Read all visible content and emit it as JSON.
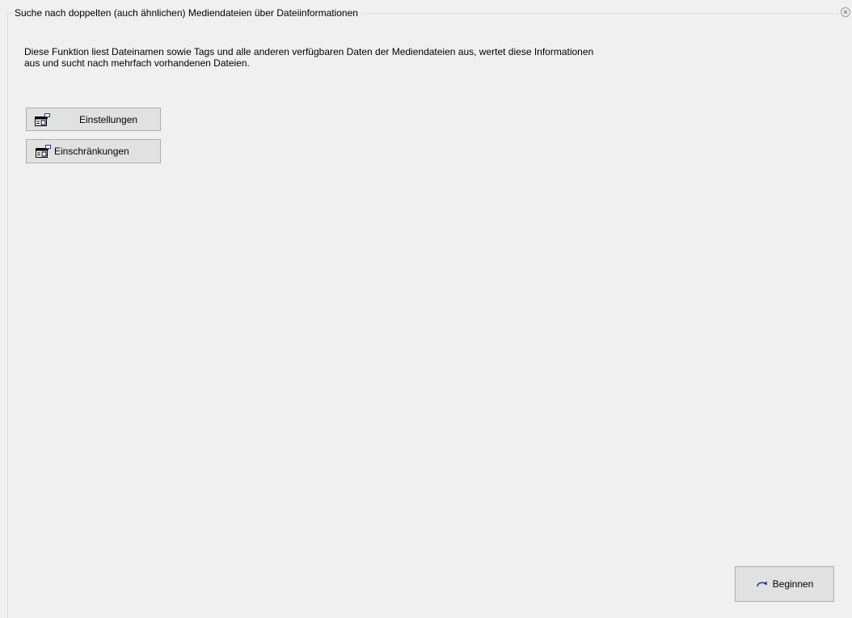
{
  "panel": {
    "title": "Suche nach doppelten (auch ähnlichen) Mediendateien über Dateiinformationen",
    "close_icon": "close-icon",
    "description": "Diese Funktion liest Dateinamen sowie Tags und alle anderen verfügbaren Daten  der Mediendateien aus, wertet diese Informationen\naus und sucht nach mehrfach vorhandenen Dateien."
  },
  "buttons": {
    "settings": {
      "label": "Einstellungen",
      "icon": "properties-icon"
    },
    "restrictions": {
      "label": "Einschränkungen",
      "icon": "properties-icon"
    },
    "start": {
      "label": "Beginnen",
      "icon": "redo-arrow-icon"
    }
  },
  "colors": {
    "background": "#f0f0f0",
    "button_face": "#e1e1e1",
    "button_border": "#adadad",
    "frame_line": "#dcdcdc",
    "icon_accent": "#1f3a93"
  }
}
